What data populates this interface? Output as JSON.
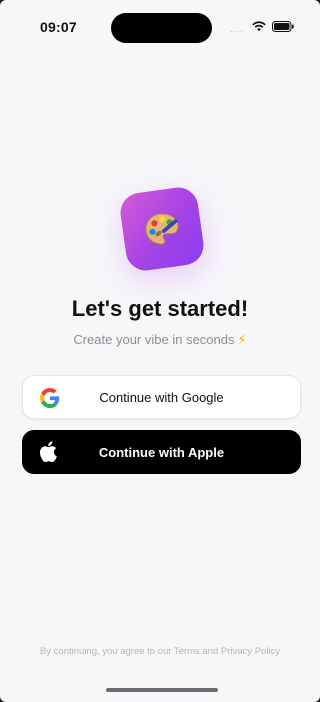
{
  "status_bar": {
    "time": "09:07",
    "signal_dots": "....",
    "icons": [
      "wifi-icon",
      "battery-icon"
    ]
  },
  "app_icon": {
    "icon": "palette-icon",
    "gradient_start": "#d45bd6",
    "gradient_end": "#8a3ff0"
  },
  "onboarding": {
    "title": "Let's get started!",
    "subtitle": "Create your vibe in seconds",
    "subtitle_emoji": "⚡"
  },
  "buttons": {
    "google_label": "Continue with Google",
    "apple_label": "Continue with Apple"
  },
  "footer": {
    "legal_text": "By continuing, you agree to our Terms and Privacy Policy"
  },
  "colors": {
    "background": "#f7f7fa",
    "apple_button": "#000000",
    "google_button": "#ffffff"
  }
}
